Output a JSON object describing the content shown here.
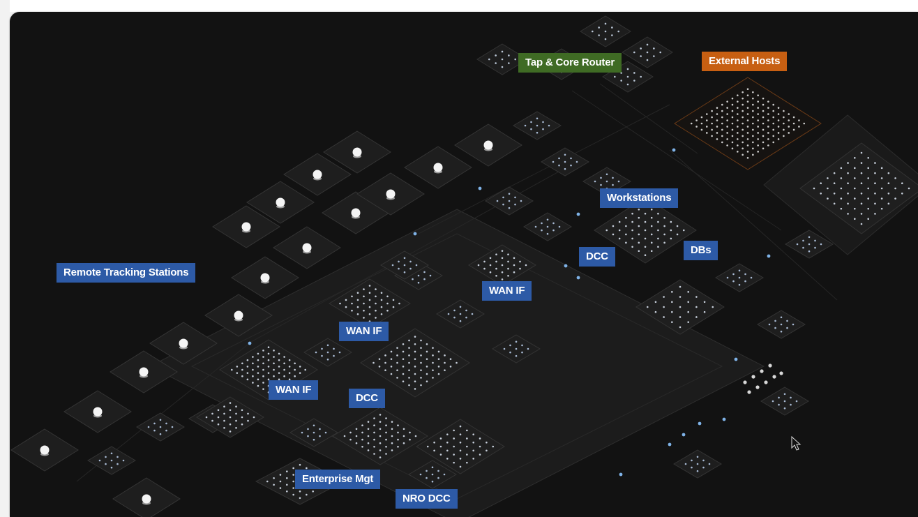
{
  "diagram": {
    "colors": {
      "background": "#121212",
      "blue_label": "#2d5aa6",
      "green_label": "#3f6b24",
      "orange_label": "#c75f12"
    },
    "labels": {
      "tap_core_router": "Tap & Core Router",
      "external_hosts": "External Hosts",
      "workstations": "Workstations",
      "dcc_right": "DCC",
      "dbs": "DBs",
      "remote_tracking_stations": "Remote Tracking Stations",
      "wan_if_center": "WAN IF",
      "wan_if_left": "WAN IF",
      "wan_if_lower": "WAN IF",
      "dcc_lower": "DCC",
      "enterprise_mgt": "Enterprise Mgt",
      "nro_dcc": "NRO DCC"
    },
    "icons": {
      "node": "server-node-icon",
      "antenna": "antenna-dish-icon",
      "cursor": "mouse-pointer-icon"
    }
  }
}
